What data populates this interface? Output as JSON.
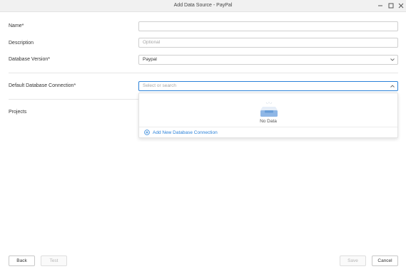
{
  "window": {
    "title": "Add Data Source - PayPal"
  },
  "form": {
    "name_label": "Name*",
    "name_value": "",
    "description_label": "Description",
    "description_placeholder": "Optional",
    "db_version_label": "Database Version*",
    "db_version_value": "Paypal",
    "default_conn_label": "Default Database Connection*",
    "default_conn_placeholder": "Select or search",
    "projects_label": "Projects"
  },
  "dropdown": {
    "empty_text": "No Data",
    "add_link_label": "Add New Database Connection"
  },
  "footer": {
    "back_label": "Back",
    "test_label": "Test",
    "save_label": "Save",
    "cancel_label": "Cancel"
  },
  "colors": {
    "accent": "#2b82d9",
    "border": "#cfcfcf",
    "titlebar": "#f1f1f1"
  }
}
